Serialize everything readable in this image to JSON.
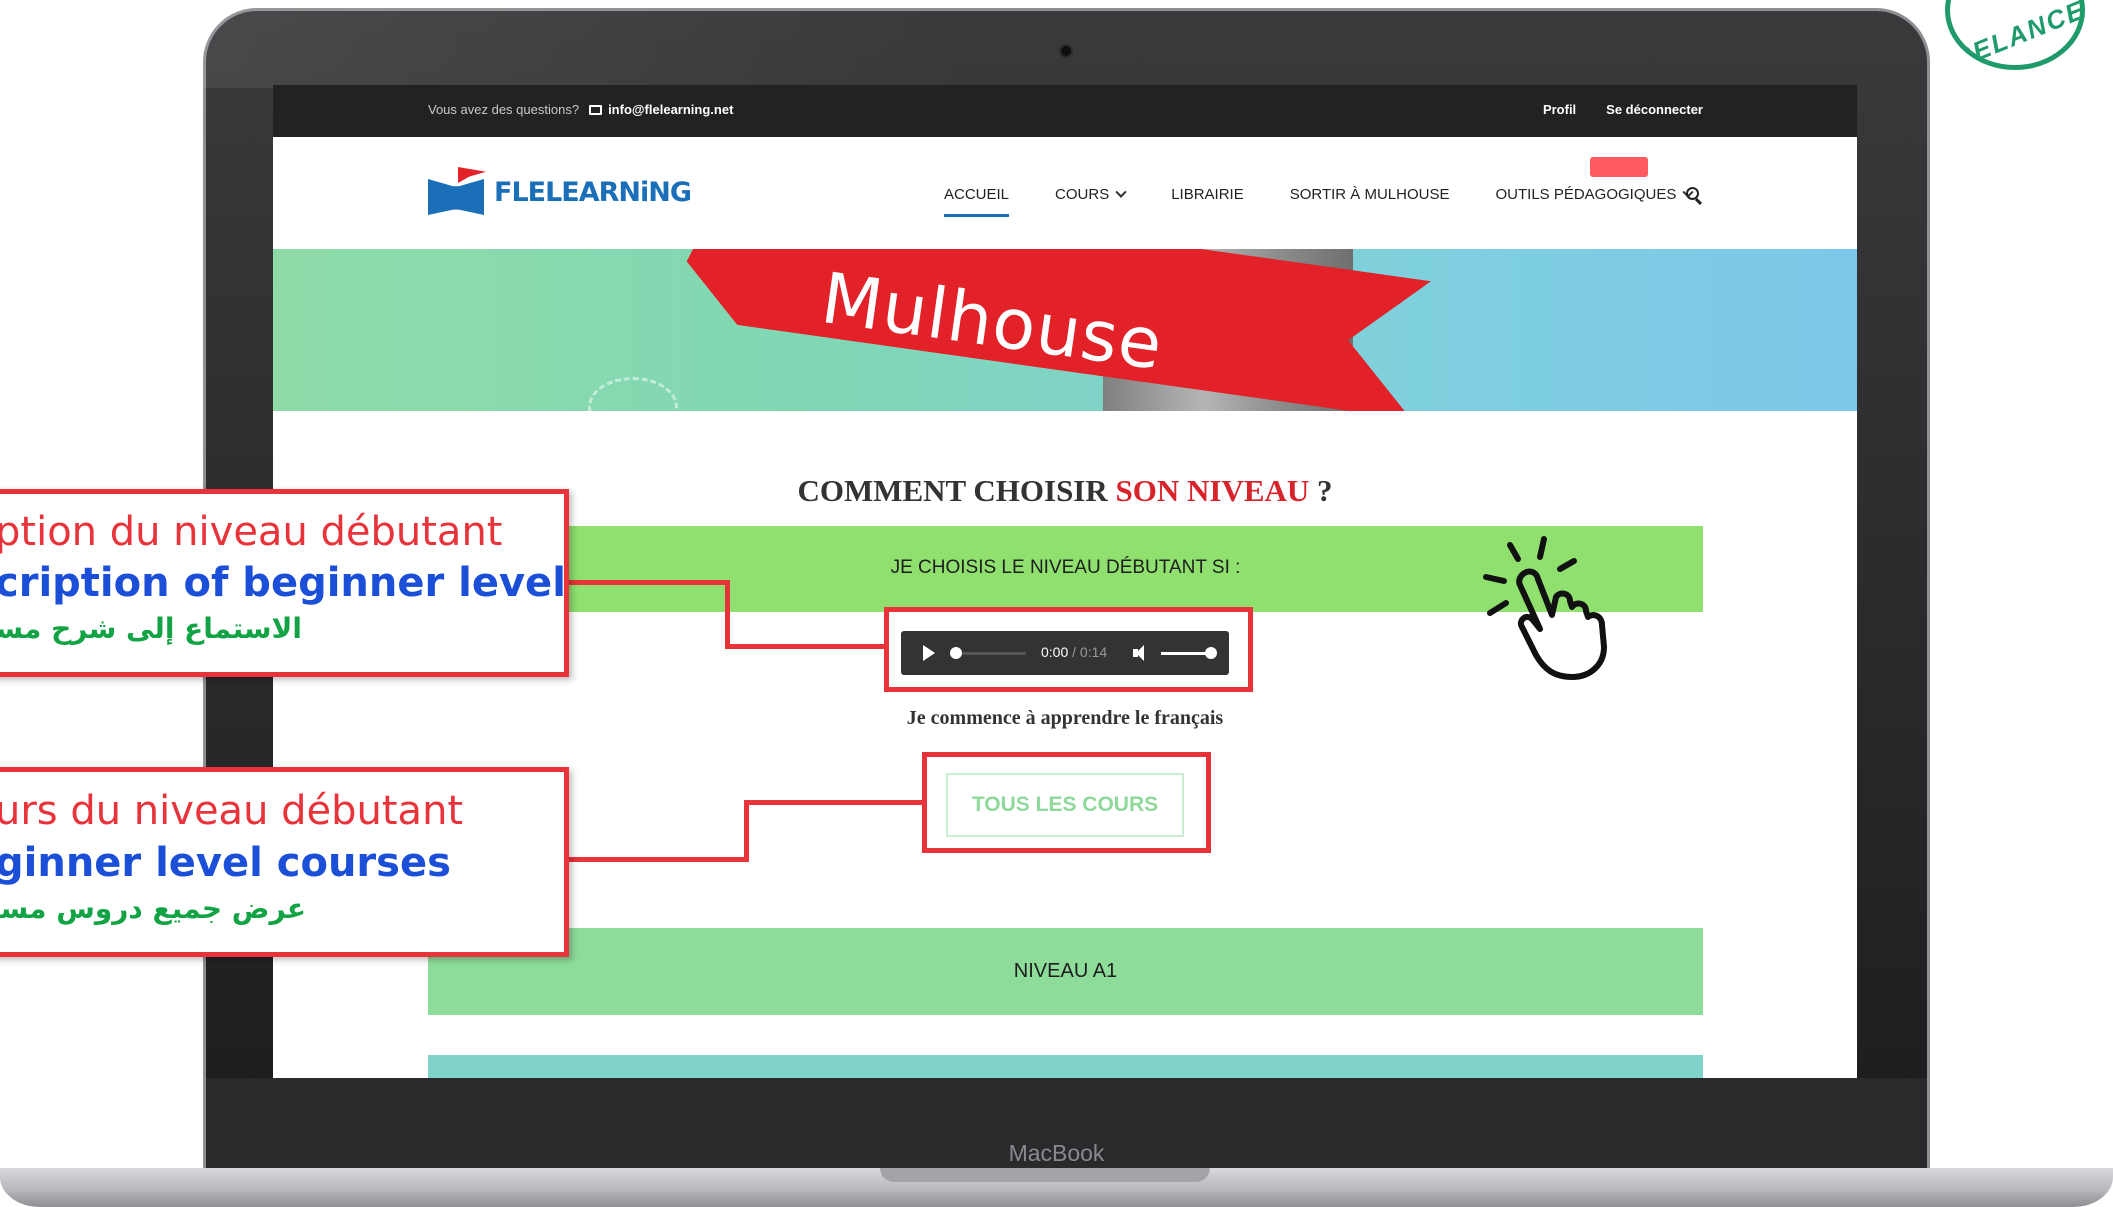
{
  "topbar": {
    "question": "Vous avez des questions?",
    "email": "info@flelearning.net",
    "profile": "Profil",
    "logout": "Se déconnecter"
  },
  "logo": {
    "text": "FLELEARNiNG"
  },
  "nav": {
    "items": [
      {
        "label": "ACCUEIL",
        "active": true,
        "dropdown": false
      },
      {
        "label": "COURS",
        "active": false,
        "dropdown": true
      },
      {
        "label": "LIBRAIRIE",
        "active": false,
        "dropdown": false
      },
      {
        "label": "SORTIR À MULHOUSE",
        "active": false,
        "dropdown": false
      },
      {
        "label": "OUTILS PÉDAGOGIQUES",
        "active": false,
        "dropdown": true
      }
    ]
  },
  "banner": {
    "text": "Mulhouse"
  },
  "main": {
    "title_part1": "COMMENT CHOISIR ",
    "title_highlight": "SON NIVEAU",
    "title_part2": " ?",
    "beginner_header": "JE CHOISIS LE NIVEAU DÉBUTANT SI :",
    "audio": {
      "current": "0:00",
      "separator": " / ",
      "duration": "0:14"
    },
    "description": "Je commence à apprendre le français",
    "courses_button": "TOUS LES COURS",
    "level_a1": "NIVEAU A1"
  },
  "callouts": [
    {
      "fr": "ption du niveau débutant",
      "en": "cription of beginner level",
      "ar": "الاستماع إلى شرح مستوى"
    },
    {
      "fr": "urs du niveau débutant",
      "en": "ginner level courses",
      "ar": "عرض جميع دروس مستوى"
    }
  ],
  "seal": {
    "text": "RELANCE"
  },
  "laptop": {
    "brand": "MacBook"
  },
  "colors": {
    "accent_blue": "#1a6fb8",
    "red": "#d9232a",
    "green_band": "#8fe06f",
    "level_band": "#8ddc9a",
    "callout_border": "#e8333a",
    "callout_fr": "#e8333a",
    "callout_en": "#1b4fd8",
    "callout_ar": "#12a344"
  }
}
